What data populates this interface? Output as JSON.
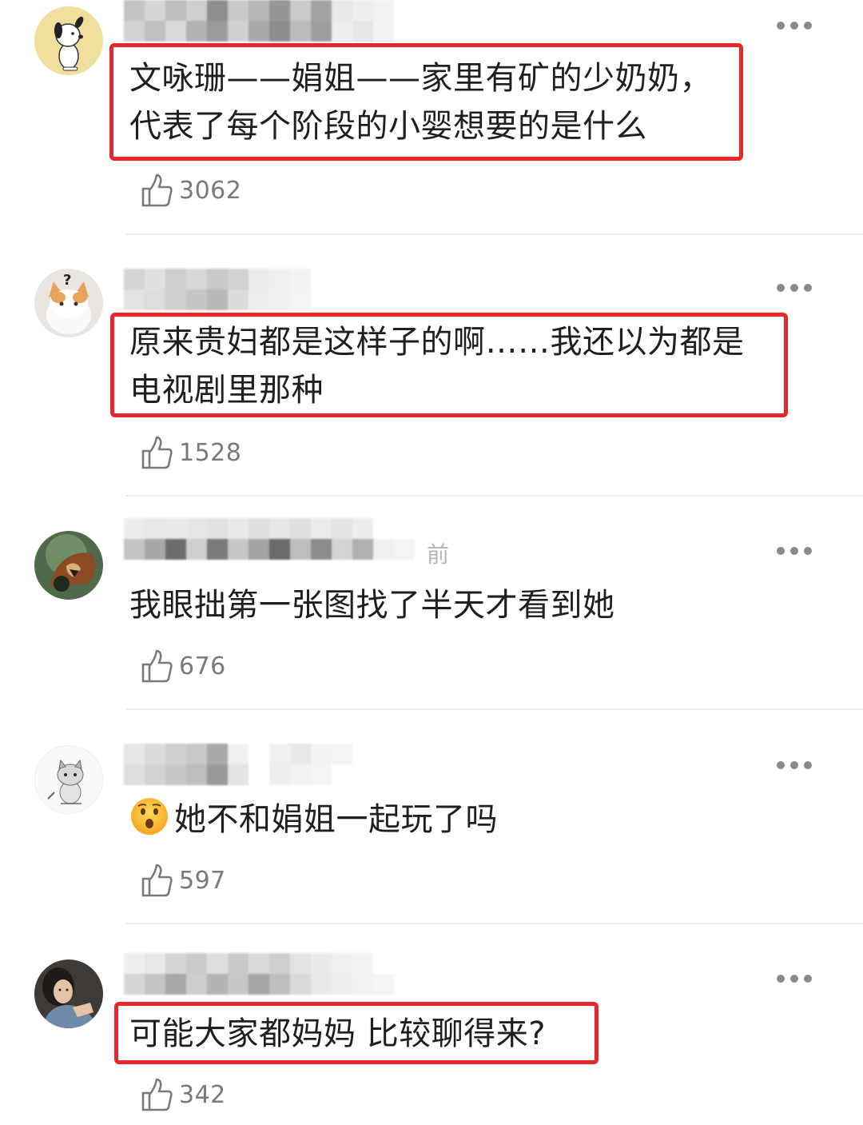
{
  "comments": [
    {
      "text_lines": [
        "文咏珊——娟姐——家里有矿的少奶奶，",
        "代表了每个阶段的小婴想要的是什么"
      ],
      "likes": "3062",
      "time_fragment": "",
      "avatar_icon": "snoopy-avatar-icon",
      "highlighted": true
    },
    {
      "text_lines": [
        "原来贵妇都是这样子的啊……我还以为都是",
        "电视剧里那种"
      ],
      "likes": "1528",
      "time_fragment": "",
      "avatar_icon": "confused-cat-avatar-icon",
      "highlighted": true
    },
    {
      "text_lines": [
        "我眼拙第一张图找了半天才看到她"
      ],
      "likes": "676",
      "time_fragment": "前",
      "avatar_icon": "roaring-lion-avatar-icon",
      "highlighted": false
    },
    {
      "text_lines": [
        "她不和娟姐一起玩了吗"
      ],
      "likes": "597",
      "time_fragment": "",
      "avatar_icon": "cartoon-cat-avatar-icon",
      "emoji_icon": "hushed-face-emoji-icon",
      "highlighted": false
    },
    {
      "text_lines": [
        "可能大家都妈妈 比较聊得来?"
      ],
      "likes": "342",
      "time_fragment": "",
      "avatar_icon": "woman-photo-avatar-icon",
      "highlighted": true
    }
  ],
  "colors": {
    "highlight_border": "#e8262c",
    "like_count": "#7a7a7a",
    "divider": "#ececec"
  }
}
